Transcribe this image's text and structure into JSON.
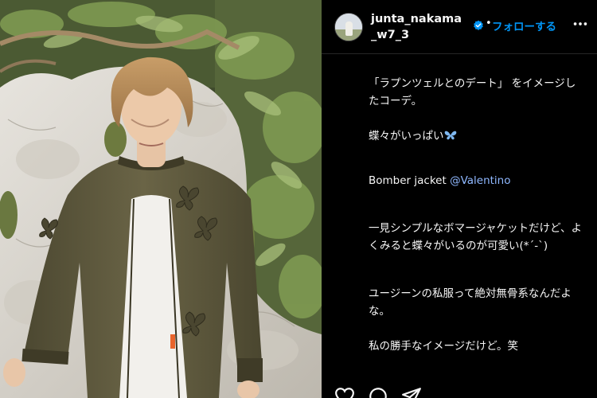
{
  "post": {
    "username": "junta_nakama_w7_3",
    "dot": "•",
    "follow_label": "フォローする",
    "caption": {
      "line1": "「ラプンツェルとのデート」 をイメージしたコーデ。",
      "line2_text": "蝶々がいっぱい",
      "bomber_text": "Bomber jacket ",
      "mention": "@Valentino",
      "para3": "一見シンプルなボマージャケットだけど、よくみると蝶々がいるのが可愛い(*´-`)",
      "para4": "ユージーンの私服って絶対無骨系なんだよな。",
      "para5": "私の勝手なイメージだけど。笑"
    }
  },
  "icons": {
    "verified": "verified-badge-icon",
    "more": "more-options-icon",
    "butterfly": "butterfly-emoji-icon",
    "like": "heart-icon",
    "comment": "comment-icon",
    "share": "share-icon"
  },
  "colors": {
    "background": "#000000",
    "follow_blue": "#0095f6",
    "mention": "#8fb8ff",
    "jacket": "#5f5a3f",
    "hair": "#b48957"
  }
}
